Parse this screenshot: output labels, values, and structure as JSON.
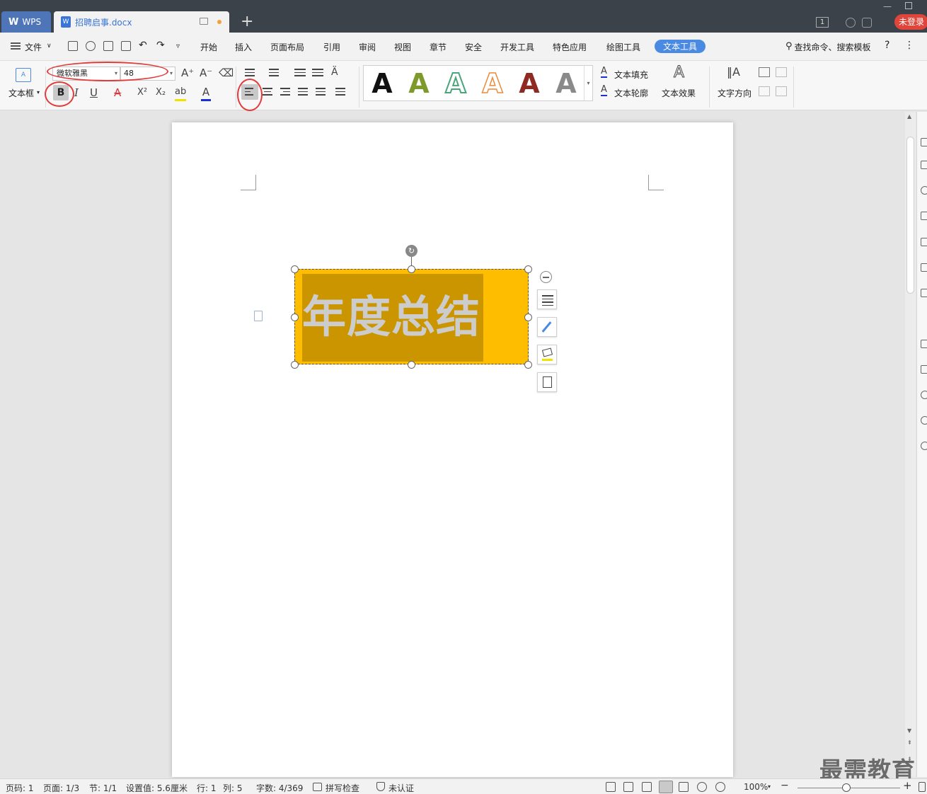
{
  "titlebar": {
    "app_tab": "WPS",
    "doc_tab": "招聘启事.docx",
    "doc_icon": "W",
    "window_badge": "1",
    "login_button": "未登录",
    "new_tab_symbol": "+"
  },
  "menubar": {
    "file_menu": "文件",
    "items": [
      "开始",
      "插入",
      "页面布局",
      "引用",
      "审阅",
      "视图",
      "章节",
      "安全",
      "开发工具",
      "特色应用",
      "绘图工具"
    ],
    "active_item": "文本工具",
    "search_text": "查找命令、搜索模板",
    "help": "?",
    "more": "⋮"
  },
  "ribbon": {
    "textframe_label": "文本框",
    "textframe_icon_text": "A",
    "font_name": "微软雅黑",
    "font_size": "48",
    "bold": "B",
    "italic": "I",
    "underline": "U",
    "strikethrough": "A",
    "superscript": "X²",
    "subscript": "X₂",
    "highlight": "ab",
    "font_color": "A",
    "grow_font": "A⁺",
    "shrink_font": "A⁻",
    "text_fill": "文本填充",
    "text_outline": "文本轮廓",
    "text_effect": "文本效果",
    "text_direction": "文字方向",
    "style_gallery": [
      {
        "glyph": "A",
        "color": "#111111"
      },
      {
        "glyph": "A",
        "color": "#7d9a2a"
      },
      {
        "glyph": "A",
        "color": "#4aa67a"
      },
      {
        "glyph": "A",
        "color": "#e98c3c"
      },
      {
        "glyph": "A",
        "color": "#8e2a22"
      },
      {
        "glyph": "A",
        "color": "#7a7a7a"
      }
    ]
  },
  "document": {
    "textbox_text": "年度总结",
    "textbox_fill": "#ffbd00",
    "selection_color": "#cb9500",
    "text_color": "#cccccc"
  },
  "watermark": "最需教育",
  "statusbar": {
    "page_num": "页码: 1",
    "pages": "页面: 1/3",
    "section": "节: 1/1",
    "setting": "设置值: 5.6厘米",
    "row": "行: 1",
    "col": "列: 5",
    "word_count": "字数: 4/369",
    "spell_check": "拼写检查",
    "cert": "未认证",
    "zoom": "100%",
    "zoom_minus": "−",
    "zoom_plus": "+"
  }
}
